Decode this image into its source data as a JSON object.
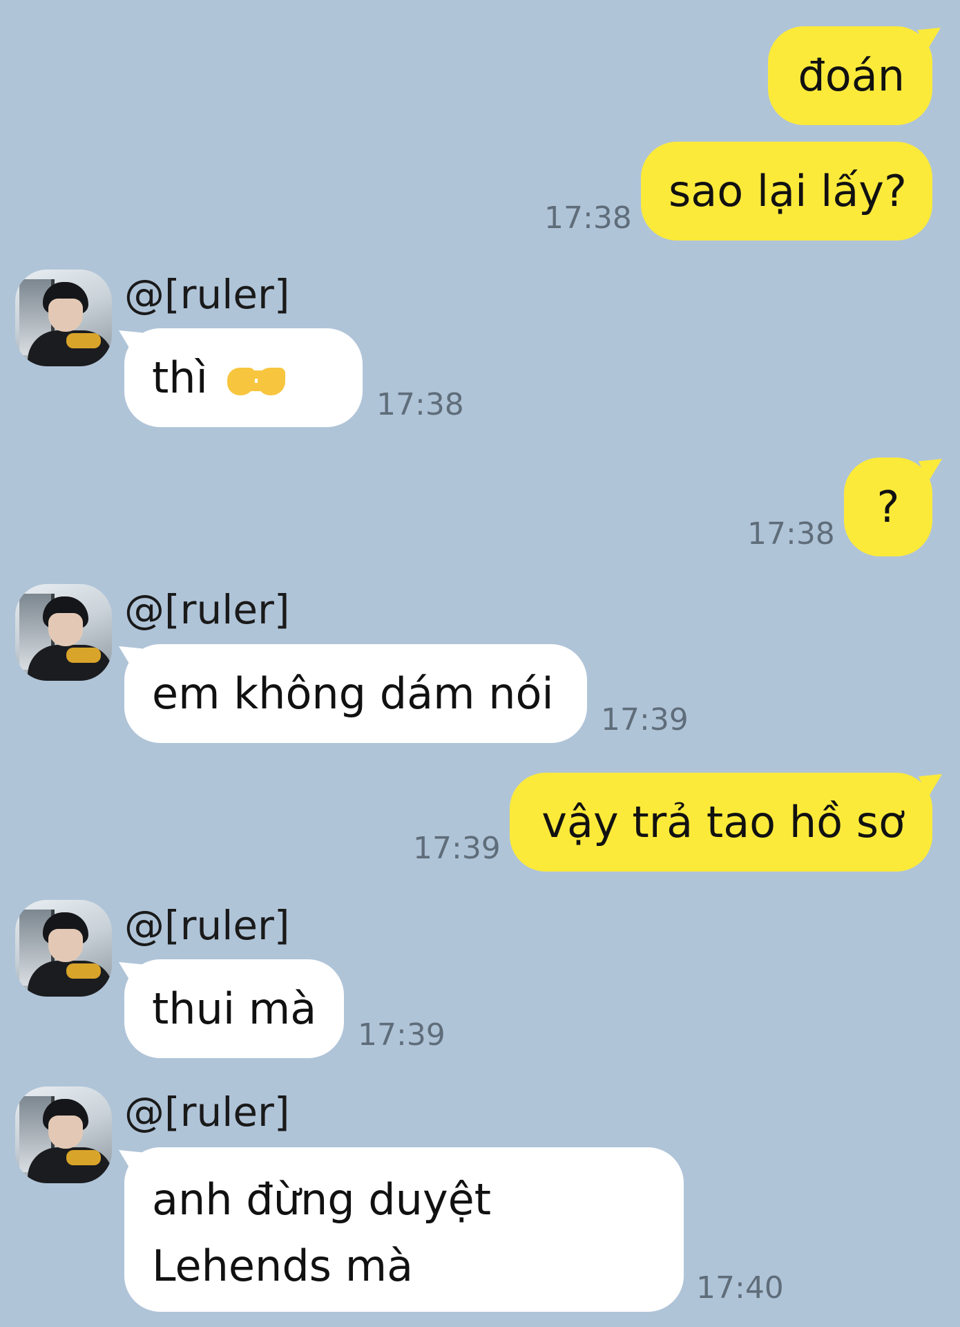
{
  "contact": {
    "name": "@[ruler]"
  },
  "messages": [
    {
      "direction": "out",
      "text": "đoán",
      "time": ""
    },
    {
      "direction": "out",
      "text": "sao lại lấy?",
      "time": "17:38"
    },
    {
      "direction": "in",
      "sender": "@[ruler]",
      "text": "thì",
      "emoji": "pointing-fingers-emoji",
      "time": "17:38"
    },
    {
      "direction": "out",
      "text": "?",
      "time": "17:38"
    },
    {
      "direction": "in",
      "sender": "@[ruler]",
      "text": "em không dám nói",
      "time": "17:39"
    },
    {
      "direction": "out",
      "text": "vậy trả tao hồ sơ",
      "time": "17:39"
    },
    {
      "direction": "in",
      "sender": "@[ruler]",
      "text": "thui mà",
      "time": "17:39"
    },
    {
      "direction": "in",
      "sender": "@[ruler]",
      "text_line1": "anh đừng duyệt",
      "text_line2": "Lehends mà",
      "time": "17:40"
    }
  ],
  "colors": {
    "background": "#b0c4d8",
    "outgoing": "#fcea3a",
    "incoming": "#ffffff",
    "timestamp": "#5f6d7a"
  }
}
